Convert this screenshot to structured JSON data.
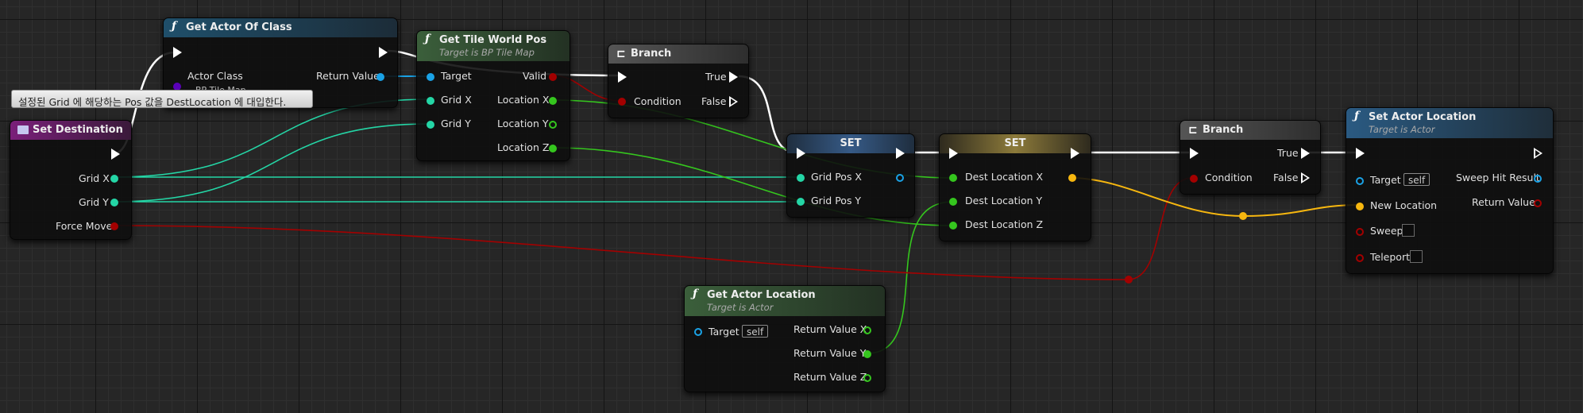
{
  "comment": {
    "text": "설정된 Grid 에 해당하는 Pos 값을 DestLocation 에 대입한다."
  },
  "colors": {
    "exec": "#ffffff",
    "object": "#1aa2e6",
    "integer": "#24d6a6",
    "float": "#35c61e",
    "bool": "#a30000",
    "struct": "#f7b70f",
    "class": "#5a00b8"
  },
  "nodes": {
    "set_destination": {
      "title": "Set Destination",
      "pins": {
        "grid_x": "Grid X",
        "grid_y": "Grid Y",
        "force_move": "Force Move"
      }
    },
    "get_actor_of_class": {
      "title": "Get Actor Of Class",
      "pins": {
        "actor_class": "Actor Class",
        "actor_class_value": "BP Tile Map",
        "return_value": "Return Value"
      }
    },
    "get_tile_world_pos": {
      "title": "Get Tile World Pos",
      "subtitle": "Target is BP Tile Map",
      "pins": {
        "target": "Target",
        "grid_x": "Grid X",
        "grid_y": "Grid Y",
        "valid": "Valid",
        "location_x": "Location X",
        "location_y": "Location Y",
        "location_z": "Location Z"
      }
    },
    "branch1": {
      "title": "Branch",
      "pins": {
        "condition": "Condition",
        "true": "True",
        "false": "False"
      }
    },
    "set1": {
      "title": "SET",
      "pins": {
        "grid_pos_x": "Grid Pos X",
        "grid_pos_y": "Grid Pos Y"
      }
    },
    "set2": {
      "title": "SET",
      "pins": {
        "dest_x": "Dest Location X",
        "dest_y": "Dest Location Y",
        "dest_z": "Dest Location Z"
      }
    },
    "branch2": {
      "title": "Branch",
      "pins": {
        "condition": "Condition",
        "true": "True",
        "false": "False"
      }
    },
    "set_actor_location": {
      "title": "Set Actor Location",
      "subtitle": "Target is Actor",
      "pins": {
        "target": "Target",
        "target_value": "self",
        "new_location": "New Location",
        "sweep": "Sweep",
        "teleport": "Teleport",
        "sweep_hit_result": "Sweep Hit Result",
        "return_value": "Return Value"
      }
    },
    "get_actor_location": {
      "title": "Get Actor Location",
      "subtitle": "Target is Actor",
      "pins": {
        "target": "Target",
        "target_value": "self",
        "return_x": "Return Value X",
        "return_y": "Return Value Y",
        "return_z": "Return Value Z"
      }
    }
  }
}
